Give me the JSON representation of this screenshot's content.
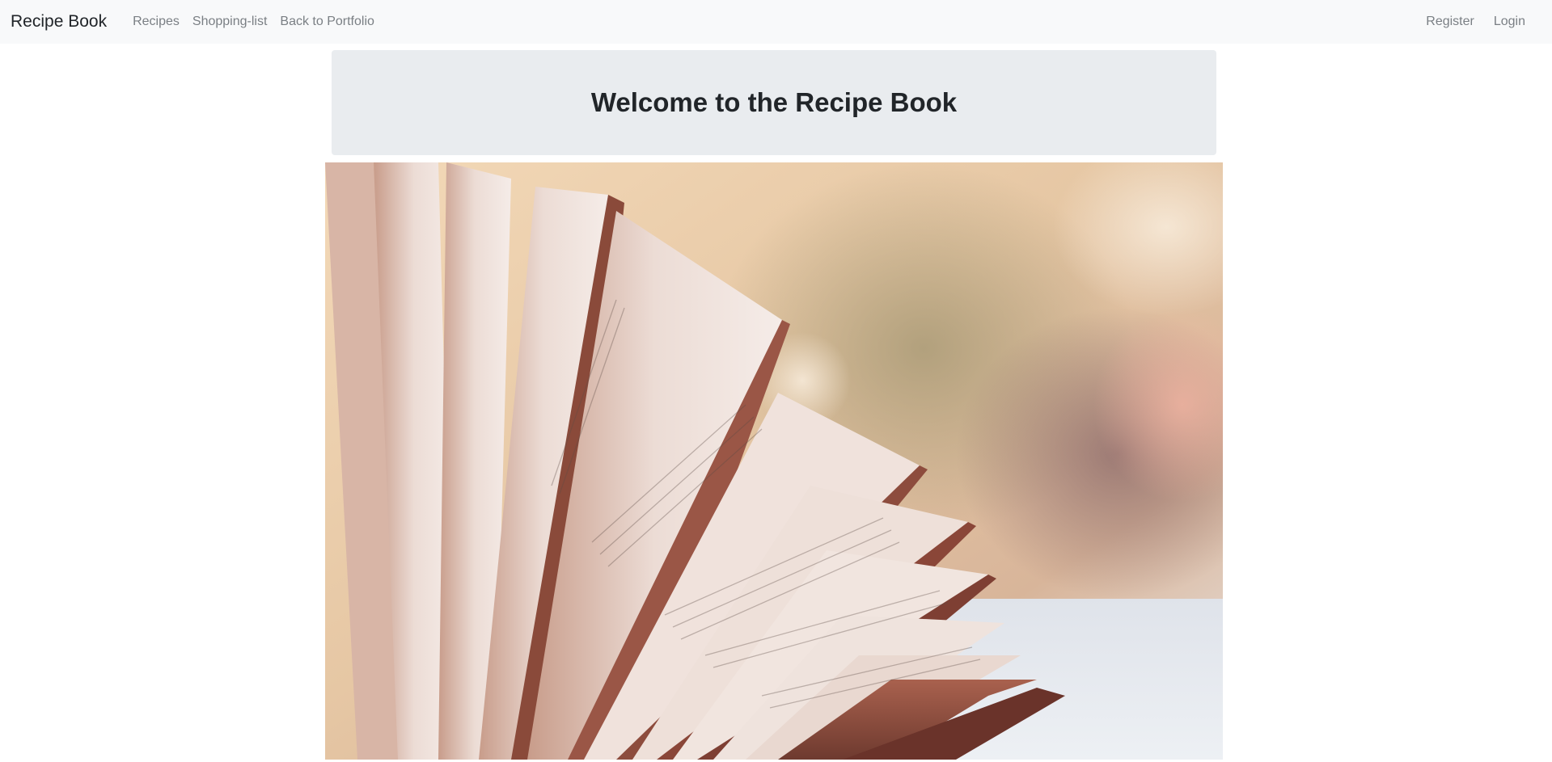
{
  "navbar": {
    "brand": "Recipe Book",
    "links_left": [
      {
        "label": "Recipes"
      },
      {
        "label": "Shopping-list"
      },
      {
        "label": "Back to Portfolio"
      }
    ],
    "links_right": [
      {
        "label": "Register"
      },
      {
        "label": "Login"
      }
    ]
  },
  "jumbotron": {
    "title": "Welcome to the Recipe Book"
  },
  "hero_image": {
    "subject": "open-book-photo"
  },
  "colors": {
    "navbar_bg": "#f8f9fa",
    "jumbotron_bg": "#e9ecef",
    "text_dark": "#212529",
    "nav_link": "#7a7f84"
  }
}
